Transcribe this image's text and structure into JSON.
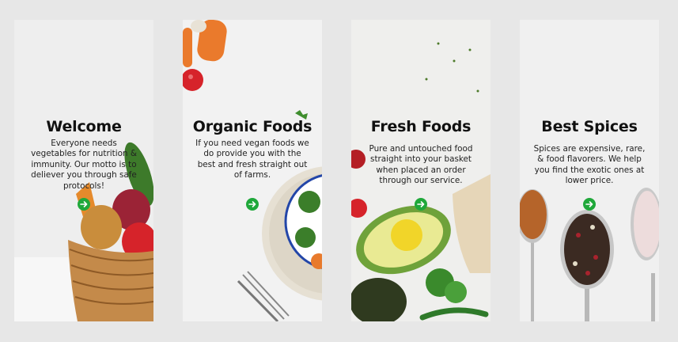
{
  "screens": [
    {
      "title": "Welcome",
      "description": "Everyone needs vegetables for nutrition & immunity. Our motto is to deliever you through safe protocols!",
      "next_icon": "arrow-right-icon"
    },
    {
      "title": "Organic Foods",
      "description": "If you need vegan foods we do provide you with the best and fresh straight out of farms.",
      "next_icon": "arrow-right-icon"
    },
    {
      "title": "Fresh Foods",
      "description": "Pure and untouched food straight into your basket when placed an order through our service.",
      "next_icon": "arrow-right-icon"
    },
    {
      "title": "Best Spices",
      "description": "Spices are expensive, rare, & food flavorers. We help you find the exotic ones at lower price.",
      "next_icon": "arrow-right-icon"
    }
  ],
  "colors": {
    "background": "#e7e7e7",
    "accent": "#1fa83a",
    "title": "#111111",
    "text": "#222222"
  }
}
